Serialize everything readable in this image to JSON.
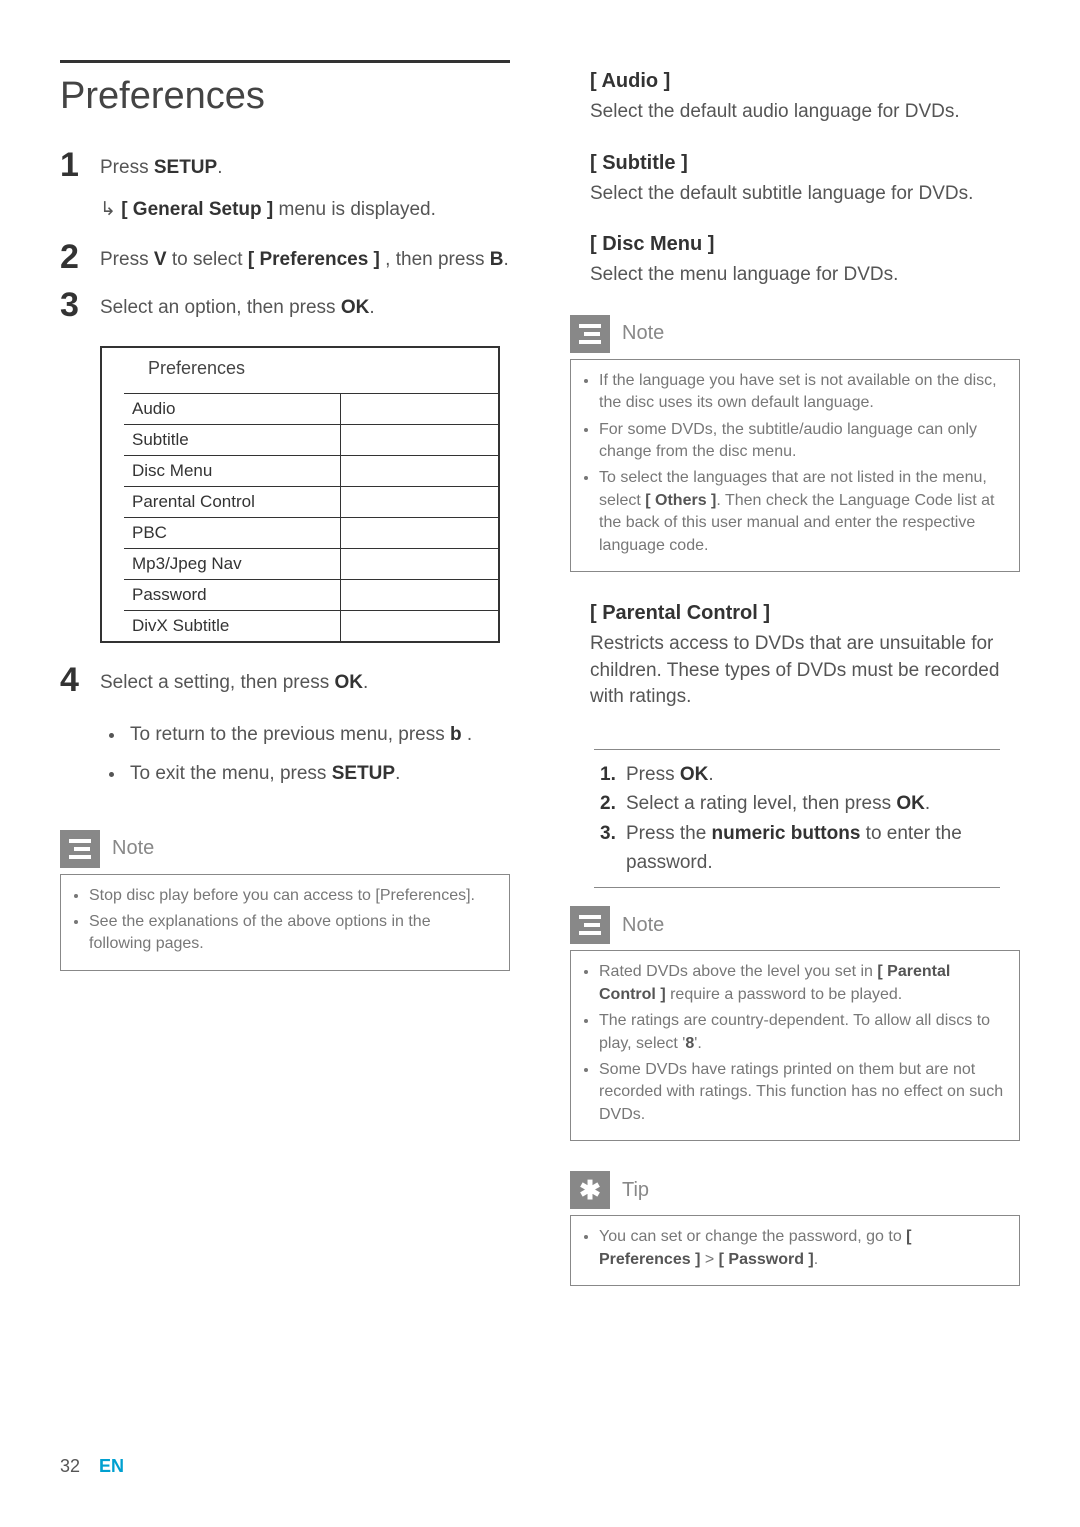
{
  "left": {
    "heading": "Preferences",
    "step1_a": "Press ",
    "step1_b": "SETUP",
    "step1_c": ".",
    "step1_result_a": "[ General Setup ]",
    "step1_result_b": " menu is displayed.",
    "step2_a": "Press ",
    "step2_b": "V",
    "step2_c": " to select ",
    "step2_d": "[ Preferences ]",
    "step2_e": " , then press ",
    "step2_f": "B",
    "step2_g": ".",
    "step3_a": "Select an option, then press ",
    "step3_b": "OK",
    "step3_c": ".",
    "menu": {
      "title": "Preferences",
      "items": [
        "Audio",
        "Subtitle",
        "Disc Menu",
        "Parental Control",
        "PBC",
        "Mp3/Jpeg Nav",
        "Password",
        "DivX Subtitle"
      ]
    },
    "step4_a": "Select a setting, then press ",
    "step4_b": "OK",
    "step4_c": ".",
    "bullet1_a": "To return to the previous menu, press ",
    "bullet1_b": "b",
    "bullet1_c": " .",
    "bullet2_a": "To exit the menu, press ",
    "bullet2_b": "SETUP",
    "bullet2_c": ".",
    "note_label": "Note",
    "note_items": [
      "Stop disc play before you can access to [Preferences].",
      "See the explanations of the above options in the following pages."
    ]
  },
  "right": {
    "audio_h": "[ Audio ]",
    "audio_b": "Select the default audio language for DVDs.",
    "subtitle_h": "[ Subtitle ]",
    "subtitle_b": "Select the default subtitle language for DVDs.",
    "discmenu_h": "[ Disc Menu ]",
    "discmenu_b": "Select the menu language for DVDs.",
    "note1_label": "Note",
    "note1_items_pre": [
      "If the language you have set is not available on the disc, the disc uses its own default language.",
      "For some DVDs, the subtitle/audio language can only change from the disc menu."
    ],
    "note1_item3_a": "To select the languages that are not listed in the menu, select ",
    "note1_item3_b": "[ Others ]",
    "note1_item3_c": ". Then check the Language Code list at the back of this user manual and enter the respective language code.",
    "parental_h": "[ Parental Control ]",
    "parental_b": "Restricts access to DVDs that are unsuitable for children. These types of DVDs must be recorded with ratings.",
    "ol": {
      "i1_a": "Press ",
      "i1_b": "OK",
      "i1_c": ".",
      "i2_a": "Select a rating level, then press ",
      "i2_b": "OK",
      "i2_c": ".",
      "i3_a": "Press the ",
      "i3_b": "numeric buttons",
      "i3_c": " to enter the password."
    },
    "note2_label": "Note",
    "note2_item1_a": "Rated DVDs above the level you set in ",
    "note2_item1_b": "[ Parental Control ]",
    "note2_item1_c": " require a password to be played.",
    "note2_item2_a": "The ratings are country-dependent. To allow all discs to play, select '",
    "note2_item2_b": "8",
    "note2_item2_c": "'.",
    "note2_item3": "Some DVDs have ratings printed on them but are not recorded with ratings.  This function has no effect on such DVDs.",
    "tip_label": "Tip",
    "tip_item_a": "You can set or change the password, go to ",
    "tip_item_b": "[ Preferences ]",
    "tip_item_c": " > ",
    "tip_item_d": "[ Password ]",
    "tip_item_e": "."
  },
  "footer": {
    "page": "32",
    "lang": "EN"
  }
}
